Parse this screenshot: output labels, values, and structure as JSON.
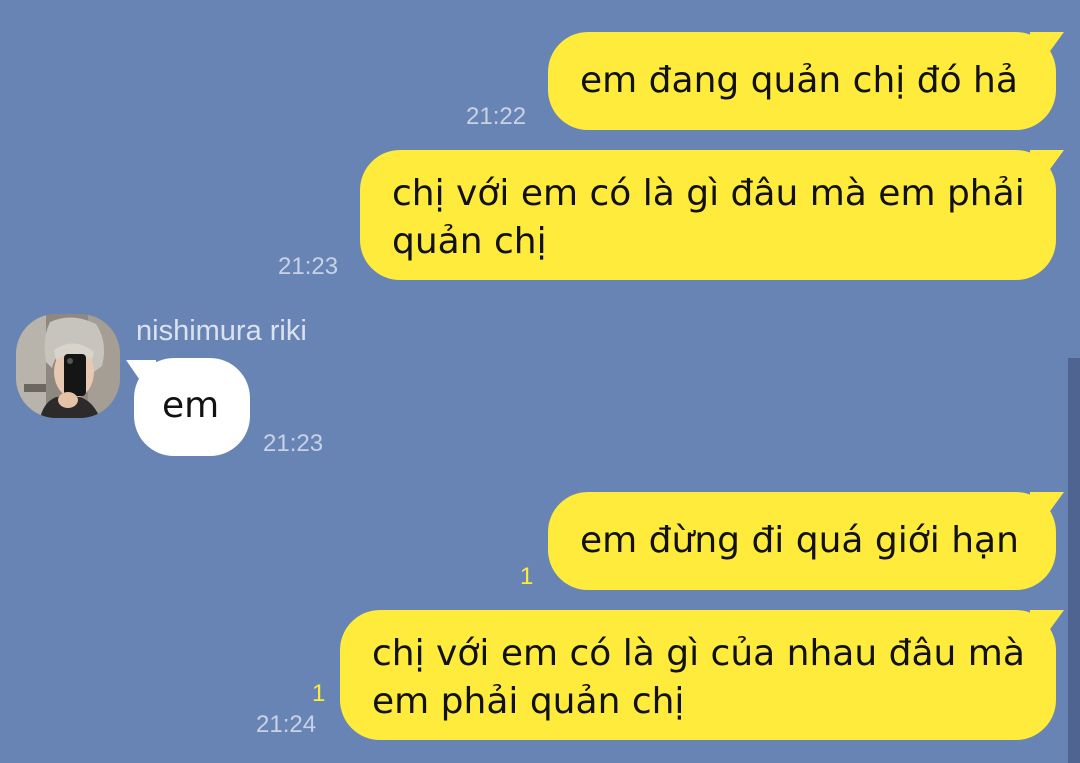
{
  "chat": {
    "contact_name": "nishimura riki",
    "messages": [
      {
        "direction": "out",
        "lines": [
          "em đang quản chị đó hả"
        ],
        "time": "21:22",
        "unread": ""
      },
      {
        "direction": "out",
        "lines": [
          "chị với em có là gì đâu mà em phải",
          "quản chị"
        ],
        "time": "21:23",
        "unread": ""
      },
      {
        "direction": "in",
        "lines": [
          "em"
        ],
        "time": "21:23",
        "unread": ""
      },
      {
        "direction": "out",
        "lines": [
          "em đừng đi quá giới hạn"
        ],
        "time": "",
        "unread": "1"
      },
      {
        "direction": "out",
        "lines": [
          "chị với em có là gì của nhau đâu mà",
          "em phải quản chị"
        ],
        "time": "21:24",
        "unread": "1"
      }
    ]
  },
  "colors": {
    "background": "#6884b4",
    "outgoing_bubble": "#ffeb3b",
    "incoming_bubble": "#ffffff",
    "unread_count": "#ffeb3b"
  }
}
